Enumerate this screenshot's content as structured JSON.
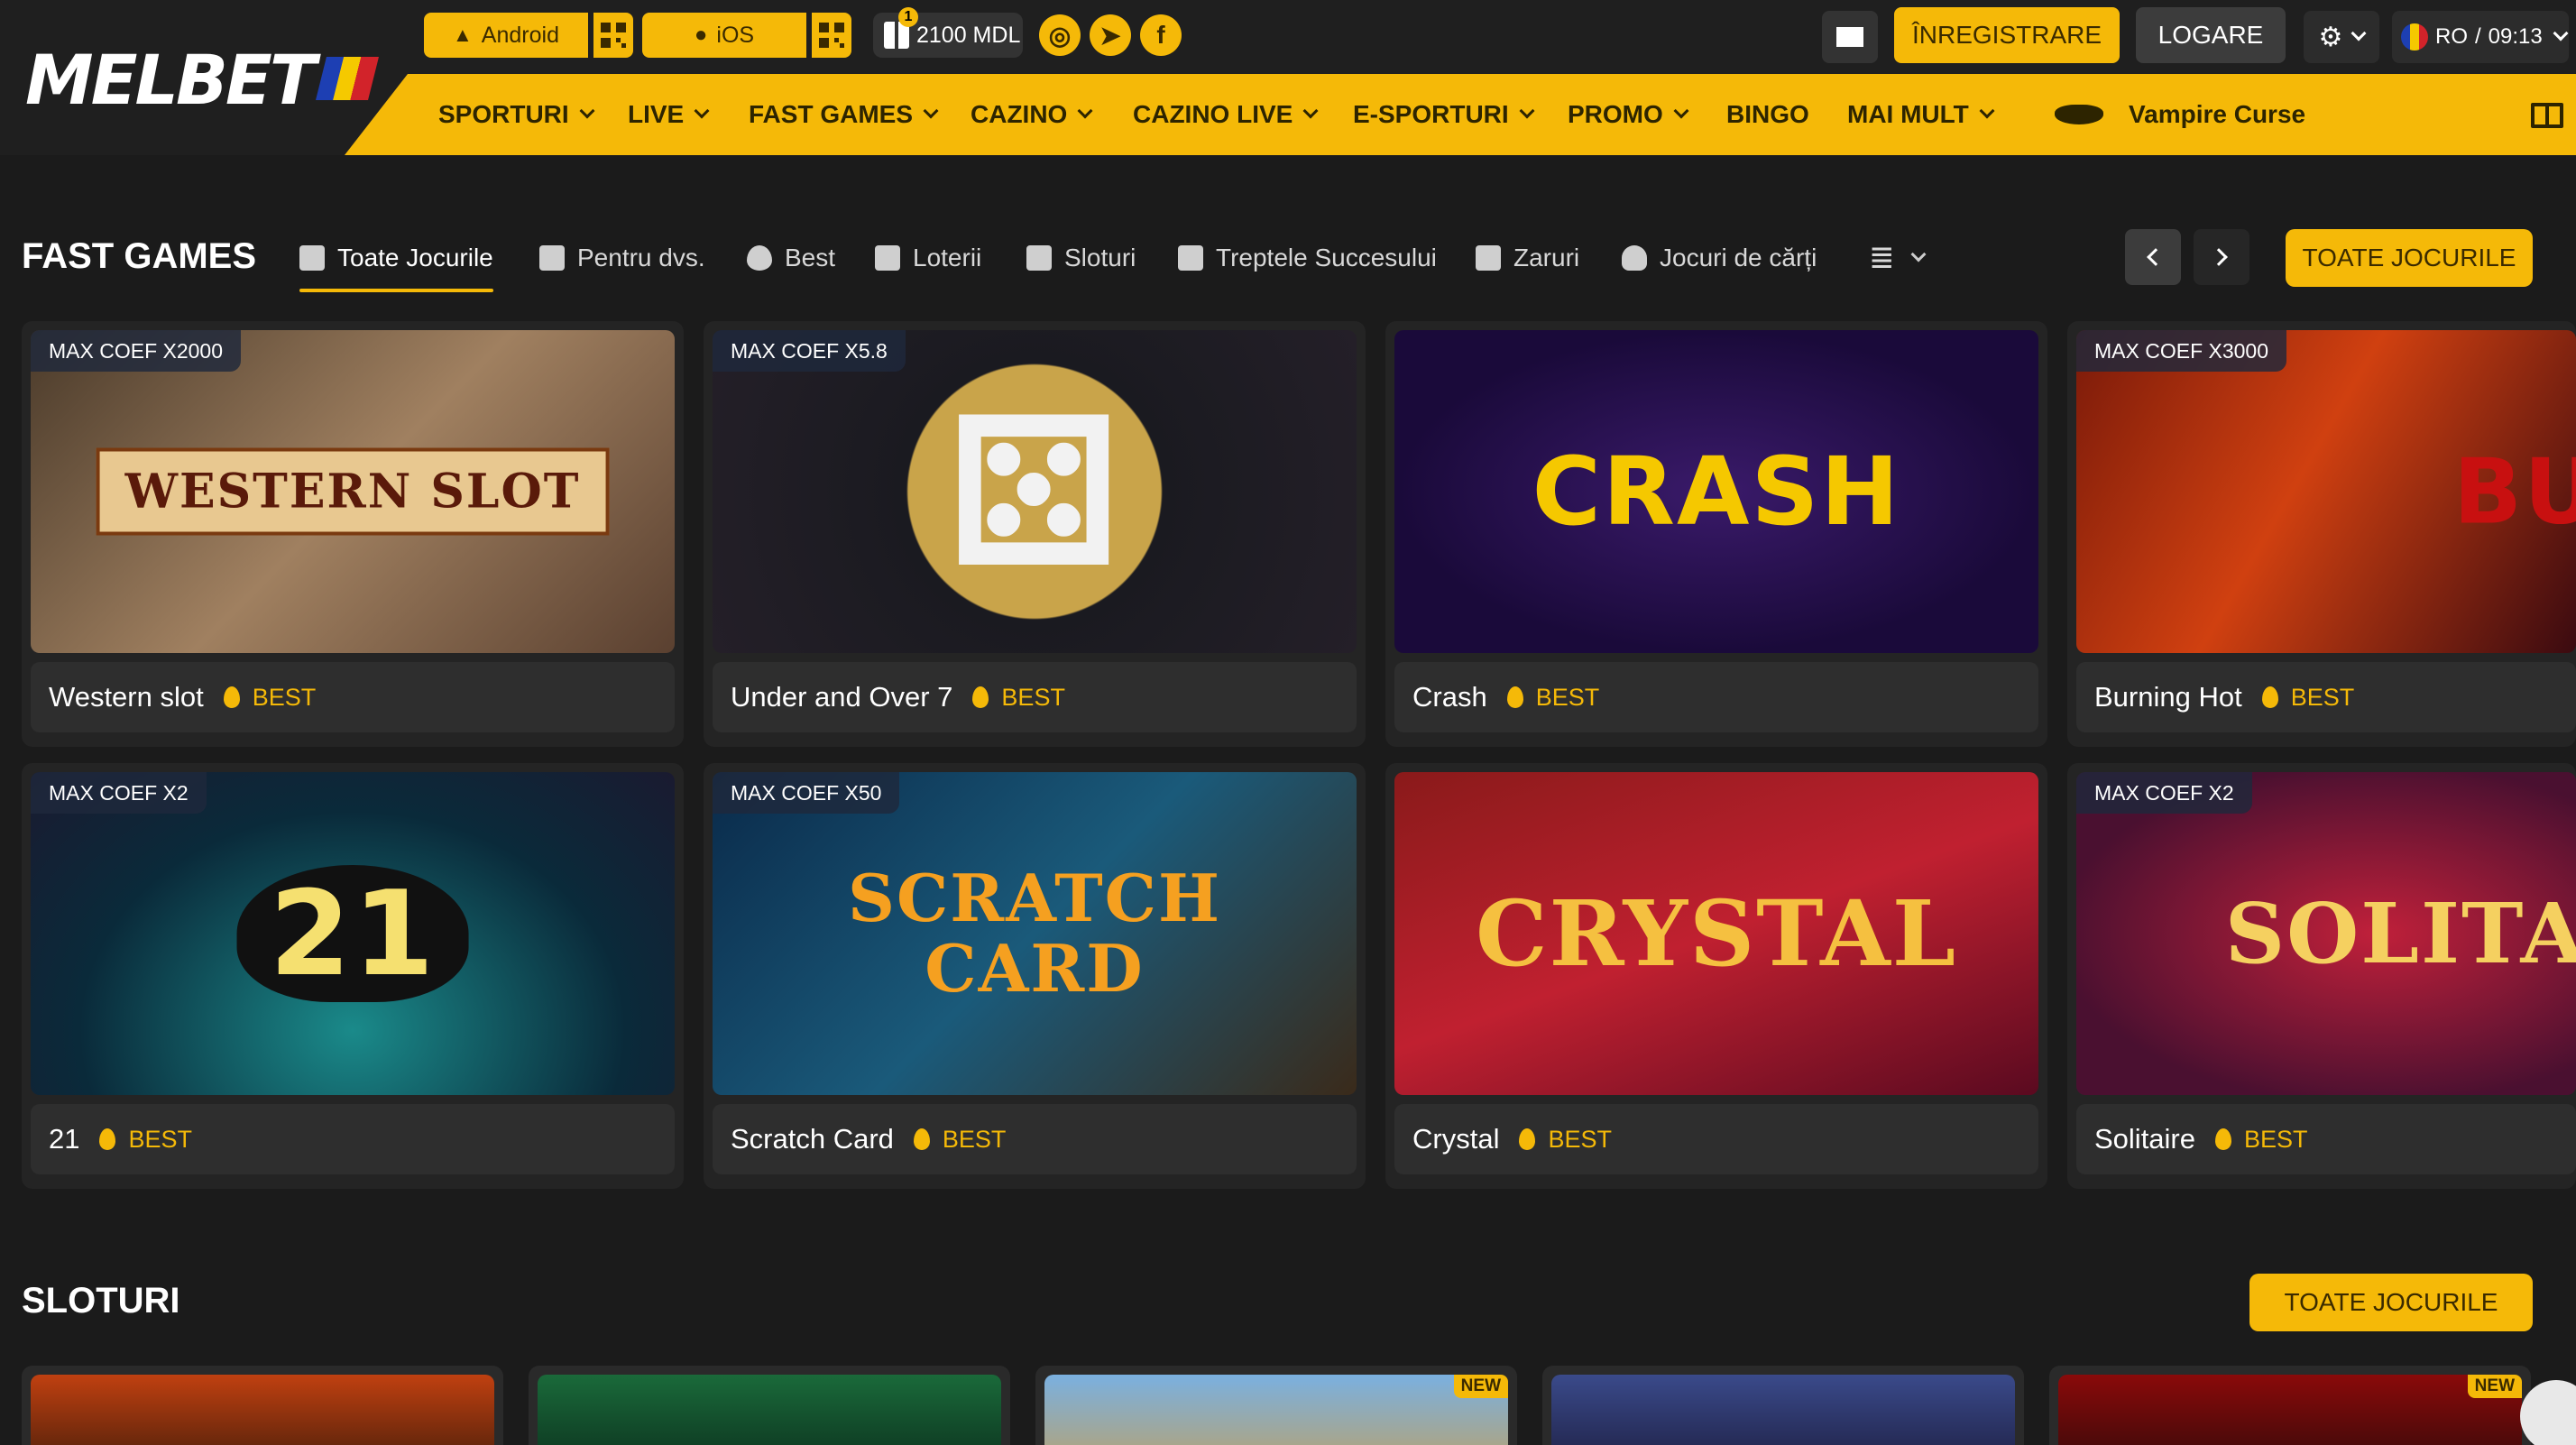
{
  "header": {
    "logo": "MELBET",
    "android_label": "Android",
    "ios_label": "iOS",
    "bonus_amount": "2100 MDL",
    "bonus_count": "1",
    "register_label": "ÎNREGISTRARE",
    "login_label": "LOGARE",
    "lang_label": "RO",
    "time": "09:13"
  },
  "nav": {
    "items": [
      "SPORTURI",
      "LIVE",
      "FAST GAMES",
      "CAZINO",
      "CAZINO LIVE",
      "E-SPORTURI",
      "PROMO",
      "BINGO",
      "MAI MULT"
    ],
    "promo_game": "Vampire Curse"
  },
  "fast_games": {
    "title": "FAST GAMES",
    "categories": [
      "Toate Jocurile",
      "Pentru dvs.",
      "Best",
      "Loterii",
      "Sloturi",
      "Treptele Succesului",
      "Zaruri",
      "Jocuri de cărți"
    ],
    "all_label": "TOATE JOCURILE",
    "games": [
      {
        "name": "Western slot",
        "coef": "MAX COEF X2000",
        "badge": "BEST",
        "art": "WESTERN SLOT"
      },
      {
        "name": "Under and Over 7",
        "coef": "MAX COEF X5.8",
        "badge": "BEST",
        "art": "⚄"
      },
      {
        "name": "Crash",
        "coef": "",
        "badge": "BEST",
        "art": "CRASH"
      },
      {
        "name": "Burning Hot",
        "coef": "MAX COEF X3000",
        "badge": "BEST",
        "art": "BU"
      },
      {
        "name": "21",
        "coef": "MAX COEF X2",
        "badge": "BEST",
        "art": "21"
      },
      {
        "name": "Scratch Card",
        "coef": "MAX COEF X50",
        "badge": "BEST",
        "art": "SCRATCH CARD"
      },
      {
        "name": "Crystal",
        "coef": "",
        "badge": "BEST",
        "art": "CRYSTAL"
      },
      {
        "name": "Solitaire",
        "coef": "MAX COEF X2",
        "badge": "BEST",
        "art": "SOLITAI"
      }
    ]
  },
  "slots": {
    "title": "SLOTURI",
    "all_label": "TOATE JOCURILE",
    "new_label": "NEW"
  },
  "colors": {
    "accent": "#f5b908",
    "background": "#1b1b1b",
    "card": "#242424"
  }
}
